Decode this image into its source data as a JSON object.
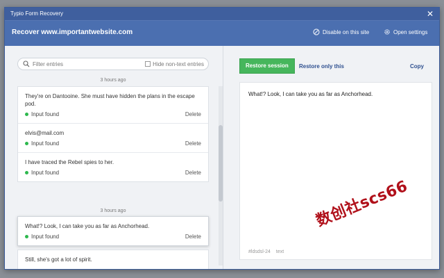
{
  "window": {
    "title": "Typio Form Recovery",
    "close_glyph": "✕"
  },
  "header": {
    "title": "Recover www.importantwebsite.com",
    "disable_label": "Disable on this site",
    "disable_icon": "block-icon",
    "settings_label": "Open settings",
    "settings_icon": "gear-icon"
  },
  "filter": {
    "placeholder": "Filter entries",
    "hide_label": "Hide non-text entries",
    "hide_checked": false
  },
  "groups": [
    {
      "time": "3 hours ago",
      "entries": [
        {
          "text": "They're on Dantooine. She must have hidden the plans in the escape pod.",
          "status": "Input found",
          "delete": "Delete"
        },
        {
          "text": "elvis@mail.com",
          "status": "Input found",
          "delete": "Delete"
        },
        {
          "text": "I have traced the Rebel spies to her.",
          "status": "Input found",
          "delete": "Delete"
        }
      ]
    },
    {
      "time": "3 hours ago",
      "entries": [
        {
          "text": "What!? Look, I can take you as far as Anchorhead.",
          "status": "Input found",
          "delete": "Delete",
          "selected": true
        },
        {
          "text": "Still, she's got a lot of spirit."
        }
      ]
    }
  ],
  "actions": {
    "restore_session": "Restore session",
    "restore_only": "Restore only this",
    "copy": "Copy"
  },
  "preview": {
    "text": "What!? Look, I can take you as far as Anchorhead.",
    "id": "#ldsdsl-24",
    "type": "text"
  },
  "watermark": "数创社scs66",
  "colors": {
    "header": "#4b6fb0",
    "titlebar": "#3f5f9e",
    "accent_green": "#46b65c",
    "link_blue": "#2e4f8f",
    "status_dot": "#2db84d",
    "watermark": "#b0101a"
  }
}
